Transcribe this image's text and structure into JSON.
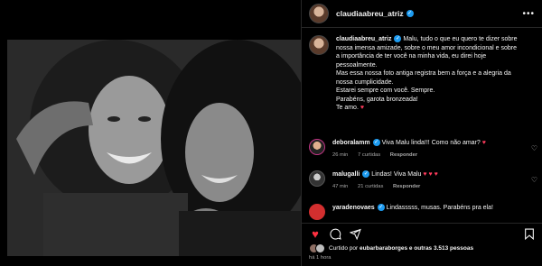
{
  "post": {
    "author": "claudiaabreu_atriz",
    "more_icon": "more-horizontal-icon"
  },
  "caption": {
    "author": "claudiaabreu_atriz",
    "lines": [
      "Malu, tudo o que eu quero te dizer sobre",
      "nossa imensa amizade, sobre o meu amor incondicional e sobre",
      "a importância de ter você na minha vida, eu direi hoje",
      "pessoalmente.",
      "Mas essa nossa foto antiga registra bem a força e a alegria da",
      "nossa cumplicidade.",
      "Estarei sempre com você. Sempre.",
      "Parabéns, garota bronzeada!",
      "Te amo."
    ],
    "heart": "♥"
  },
  "comments": [
    {
      "user": "deboralamm",
      "text": "Viva Malu linda!!! Como não amar?",
      "heart": "♥",
      "time": "26 min",
      "likes": "7 curtidas",
      "reply": "Responder"
    },
    {
      "user": "malugalli",
      "text": "Lindas! Viva Malu",
      "heart": "♥ ♥ ♥",
      "time": "47 min",
      "likes": "21 curtidas",
      "reply": "Responder"
    },
    {
      "user": "yaradenovaes",
      "text": "Lindasssss, musas. Parabéns pra ela!",
      "heart": "",
      "time": "",
      "likes": "",
      "reply": ""
    }
  ],
  "actions": {
    "like_icon": "heart-filled-icon",
    "comment_icon": "comment-icon",
    "share_icon": "share-icon",
    "save_icon": "bookmark-icon"
  },
  "likes": {
    "prefix": "Curtido por",
    "user": "eubarbaraborges",
    "suffix": "e outras 3.513 pessoas"
  },
  "timestamp": "há 1 hora",
  "colors": {
    "accent_like": "#ff3040",
    "verified": "#1d9bf0",
    "muted": "#a8a8a8"
  }
}
